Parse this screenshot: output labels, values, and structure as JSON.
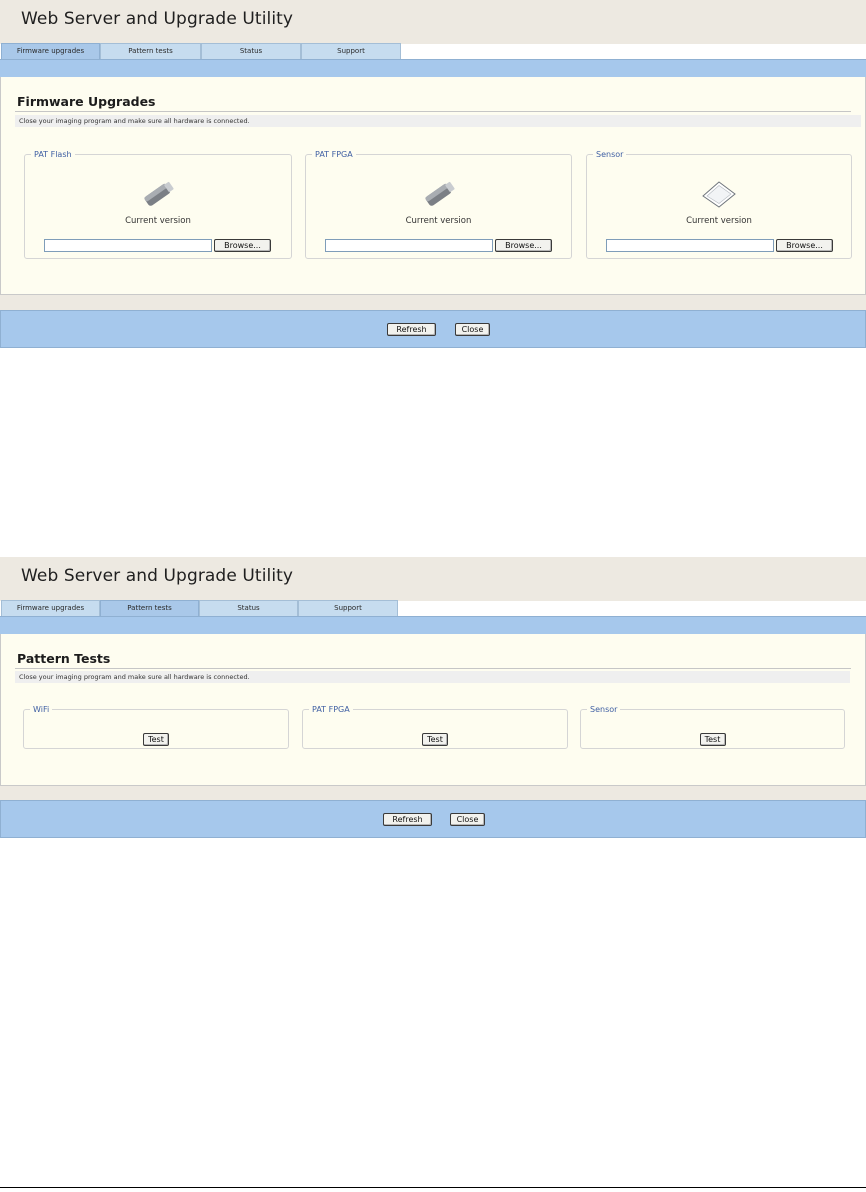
{
  "app_title": "Web Server and Upgrade Utility",
  "colors": {
    "tab_bar": "#a6c8ec",
    "panel_bg": "#fefdf0",
    "legend_text": "#3f5fa3",
    "title_bar": "#ede9e1"
  },
  "tabs": [
    {
      "label": "Firmware upgrades"
    },
    {
      "label": "Pattern tests"
    },
    {
      "label": "Status"
    },
    {
      "label": "Support"
    }
  ],
  "footer": {
    "refresh_label": "Refresh",
    "close_label": "Close"
  },
  "firmware": {
    "active_tab": "Firmware upgrades",
    "heading": "Firmware Upgrades",
    "instruction": "Close your imaging program and make sure all hardware is connected.",
    "groups": [
      {
        "legend": "PAT Flash",
        "icon": "flash-drive-icon",
        "version_label": "Current version",
        "file_value": "",
        "browse_label": "Browse..."
      },
      {
        "legend": "PAT FPGA",
        "icon": "flash-drive-icon",
        "version_label": "Current version",
        "file_value": "",
        "browse_label": "Browse..."
      },
      {
        "legend": "Sensor",
        "icon": "sensor-icon",
        "version_label": "Current version",
        "file_value": "",
        "browse_label": "Browse..."
      }
    ]
  },
  "pattern": {
    "active_tab": "Pattern tests",
    "heading": "Pattern Tests",
    "instruction": "Close your imaging program and make sure all hardware is connected.",
    "groups": [
      {
        "legend": "WiFi",
        "test_label": "Test"
      },
      {
        "legend": "PAT FPGA",
        "test_label": "Test"
      },
      {
        "legend": "Sensor",
        "test_label": "Test"
      }
    ]
  }
}
